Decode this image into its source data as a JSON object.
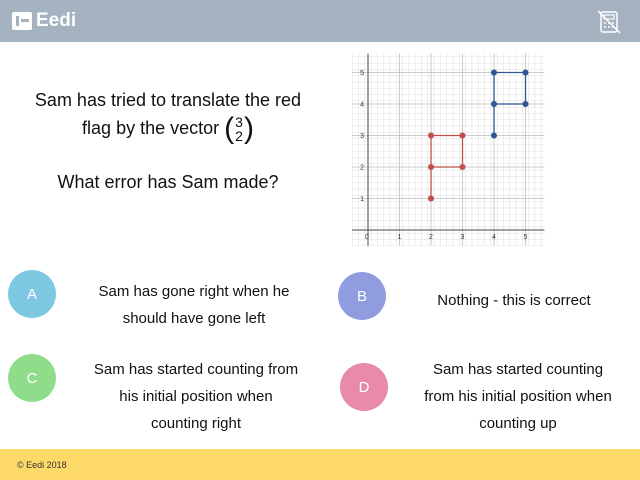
{
  "header": {
    "logo_text": "Eedi",
    "calculator_icon": "calculator-disabled-icon",
    "background": "#a5b3c0"
  },
  "question": {
    "line1": "Sam has tried to translate the red",
    "line2": "flag by the vector",
    "vector_top": "3",
    "vector_bottom": "2",
    "line3": "What error has Sam made?"
  },
  "graph": {
    "x_ticks": [
      "0",
      "1",
      "2",
      "3",
      "4",
      "5"
    ],
    "y_ticks": [
      "1",
      "2",
      "3",
      "4",
      "5"
    ],
    "red_flag": [
      [
        2,
        1
      ],
      [
        2,
        2
      ],
      [
        2,
        3
      ],
      [
        3,
        3
      ],
      [
        3,
        2
      ],
      [
        2,
        2
      ]
    ],
    "red_points": [
      [
        2,
        1
      ],
      [
        2,
        2
      ],
      [
        2,
        3
      ],
      [
        3,
        3
      ],
      [
        3,
        2
      ]
    ],
    "blue_flag": [
      [
        4,
        3
      ],
      [
        4,
        4
      ],
      [
        4,
        5
      ],
      [
        5,
        5
      ],
      [
        5,
        4
      ],
      [
        4,
        4
      ]
    ],
    "blue_points": [
      [
        4,
        3
      ],
      [
        4,
        4
      ],
      [
        4,
        5
      ],
      [
        5,
        5
      ],
      [
        5,
        4
      ]
    ],
    "red_color": "#c0504d",
    "blue_color": "#2f5597"
  },
  "options": {
    "a": {
      "letter": "A",
      "line1": "Sam has gone right when he",
      "line2": "should have gone left",
      "color": "#7ec8e3"
    },
    "b": {
      "letter": "B",
      "line1": "Nothing - this is correct",
      "color": "#8f9de0"
    },
    "c": {
      "letter": "C",
      "line1": "Sam has started counting from",
      "line2": "his initial position when",
      "line3": "counting right",
      "color": "#8fdc8a"
    },
    "d": {
      "letter": "D",
      "line1": "Sam has started counting",
      "line2": "from his initial position when",
      "line3": "counting up",
      "color": "#e88aa8"
    }
  },
  "footer": {
    "copyright": "© Eedi 2018",
    "background": "#fdd967"
  }
}
